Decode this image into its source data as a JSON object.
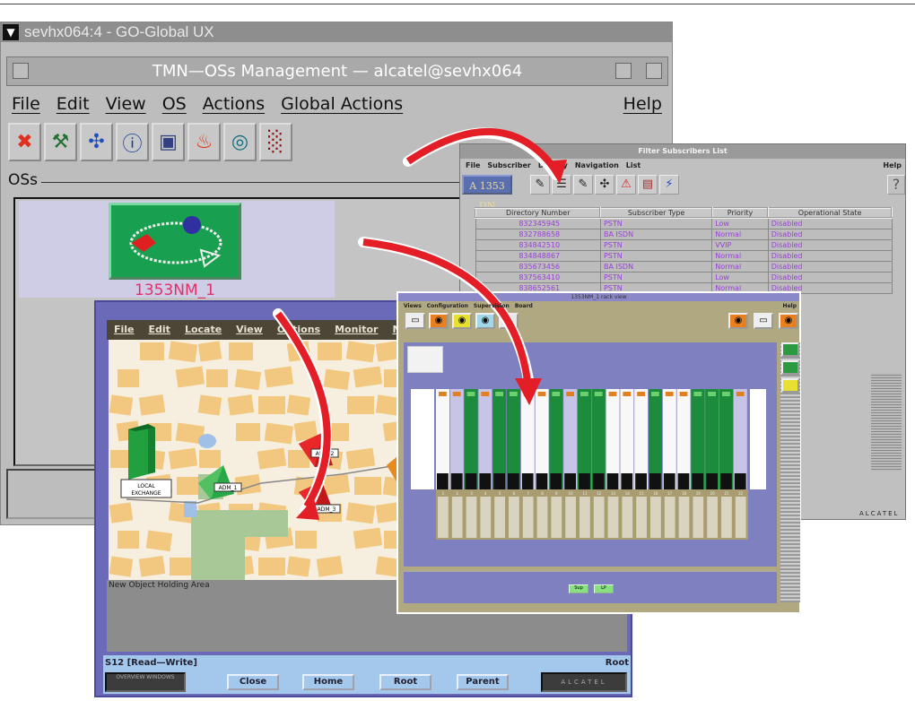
{
  "main_window": {
    "outer_title": "sevhx064:4 - GO-Global UX",
    "title": "TMN—OSs Management — alcatel@sevhx064",
    "menu": [
      "File",
      "Edit",
      "View",
      "OS",
      "Actions",
      "Global Actions"
    ],
    "help": "Help",
    "toolbar": [
      {
        "icon": "close-icon",
        "glyph": "✖",
        "color": "#e03020"
      },
      {
        "icon": "tools-icon",
        "glyph": "⚒",
        "color": "#207030"
      },
      {
        "icon": "network-icon",
        "glyph": "✣",
        "color": "#2050c0"
      },
      {
        "icon": "info-icon",
        "glyph": "ⓘ",
        "color": "#1040a0"
      },
      {
        "icon": "monitor-icon",
        "glyph": "▣",
        "color": "#304080"
      },
      {
        "icon": "alarm-fire-icon",
        "glyph": "♨",
        "color": "#e03010"
      },
      {
        "icon": "globe-icon",
        "glyph": "◎",
        "color": "#107080"
      },
      {
        "icon": "chart-icon",
        "glyph": "░",
        "color": "#901010"
      }
    ],
    "group_label": "OSs",
    "os_item": "1353NM_1"
  },
  "filter_window": {
    "title": "Filter Subscribers List",
    "menu": [
      "File",
      "Subscriber",
      "Display",
      "Navigation",
      "List"
    ],
    "help": "Help",
    "badge": "A 1353 DN",
    "help_button": "?",
    "columns": [
      "Directory Number",
      "Subscriber Type",
      "Priority",
      "Operational State"
    ],
    "rows": [
      [
        "832345945",
        "PSTN",
        "Low",
        "Disabled"
      ],
      [
        "832788658",
        "BA ISDN",
        "Normal",
        "Disabled"
      ],
      [
        "834842510",
        "PSTN",
        "VVIP",
        "Disabled"
      ],
      [
        "834848867",
        "PSTN",
        "Normal",
        "Disabled"
      ],
      [
        "835673456",
        "BA ISDN",
        "Normal",
        "Disabled"
      ],
      [
        "837563410",
        "PSTN",
        "Low",
        "Disabled"
      ],
      [
        "838652561",
        "PSTN",
        "Normal",
        "Disabled"
      ]
    ],
    "brand": "ALCATEL"
  },
  "equipment_window": {
    "title": "1353NM_1 rack view",
    "menu": [
      "Views",
      "Configuration",
      "Supervision",
      "Board"
    ],
    "help": "Help",
    "slot_numbers": [
      "1",
      "2",
      "3",
      "4",
      "5",
      "6",
      "7",
      "8",
      "9",
      "10",
      "11",
      "12",
      "13",
      "14",
      "15",
      "16",
      "17",
      "18",
      "19",
      "20",
      "21",
      "22"
    ],
    "slot_types": [
      "white",
      "lav",
      "green",
      "lav",
      "green",
      "green",
      "white",
      "white",
      "green",
      "lav",
      "green",
      "green",
      "white",
      "white",
      "white",
      "green",
      "white",
      "white",
      "green",
      "green",
      "green",
      "lav"
    ],
    "bottom_buttons": [
      "Sup",
      "LP"
    ]
  },
  "map_window": {
    "title": "Root",
    "menu": [
      "File",
      "Edit",
      "Locate",
      "View",
      "Options",
      "Monitor",
      "Mi"
    ],
    "labels": {
      "local_exchange": "LOCAL EXCHANGE",
      "adm1": "ADM_1",
      "adm2": "ADM_2",
      "adm3": "ADM_3"
    },
    "holding_area": "New Object Holding Area",
    "status": "S12 [Read—Write]",
    "status_right": "Root",
    "overview": "OVERVIEW WINDOWS",
    "buttons": [
      "Close",
      "Home",
      "Root",
      "Parent"
    ],
    "brand": "ALCATEL"
  },
  "colors": {
    "arrow": "#e41e26",
    "os_green": "#18a050",
    "map_bg": "#f6efe0",
    "block": "#f2c880"
  }
}
